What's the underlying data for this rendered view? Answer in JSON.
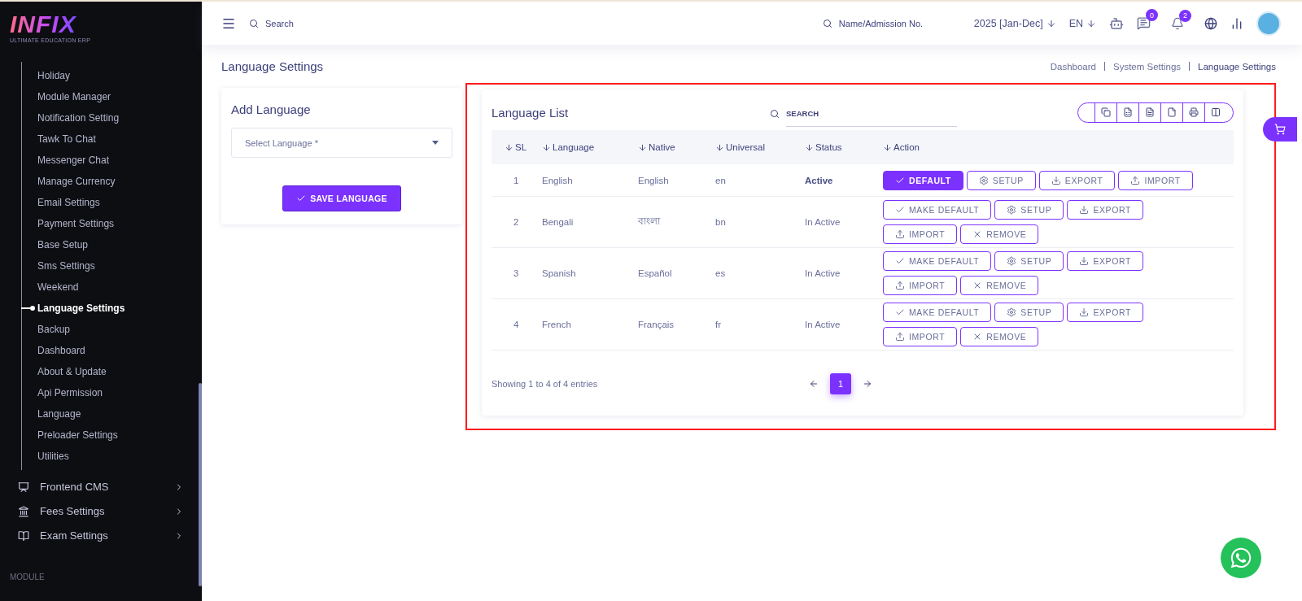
{
  "sidebar": {
    "logo": {
      "name": "INFIX",
      "tagline": "ULTIMATE EDUCATION ERP"
    },
    "sub_items": [
      {
        "label": "Holiday",
        "selected": false
      },
      {
        "label": "Module Manager",
        "selected": false
      },
      {
        "label": "Notification Setting",
        "selected": false
      },
      {
        "label": "Tawk To Chat",
        "selected": false
      },
      {
        "label": "Messenger Chat",
        "selected": false
      },
      {
        "label": "Manage Currency",
        "selected": false
      },
      {
        "label": "Email Settings",
        "selected": false
      },
      {
        "label": "Payment Settings",
        "selected": false
      },
      {
        "label": "Base Setup",
        "selected": false
      },
      {
        "label": "Sms Settings",
        "selected": false
      },
      {
        "label": "Weekend",
        "selected": false
      },
      {
        "label": "Language Settings",
        "selected": true
      },
      {
        "label": "Backup",
        "selected": false
      },
      {
        "label": "Dashboard",
        "selected": false
      },
      {
        "label": "About & Update",
        "selected": false
      },
      {
        "label": "Api Permission",
        "selected": false
      },
      {
        "label": "Language",
        "selected": false
      },
      {
        "label": "Preloader Settings",
        "selected": false
      },
      {
        "label": "Utilities",
        "selected": false
      }
    ],
    "groups": [
      {
        "label": "Frontend CMS",
        "kind": "cms"
      },
      {
        "label": "Fees Settings",
        "kind": "fees"
      },
      {
        "label": "Exam Settings",
        "kind": "exam"
      }
    ],
    "section_label": "MODULE"
  },
  "topbar": {
    "search_placeholder": "Search",
    "student_search_placeholder": "Name/Admission No.",
    "session": "2025 [Jan-Dec]",
    "language": "EN",
    "messages_count": "0",
    "notifications_count": "2"
  },
  "page_title": "Language Settings",
  "breadcrumb": [
    "Dashboard",
    "System Settings",
    "Language Settings"
  ],
  "add_language": {
    "title": "Add Language",
    "select_placeholder": "Select Language *",
    "save_button": "SAVE LANGUAGE"
  },
  "language_list": {
    "title": "Language List",
    "search_placeholder": "SEARCH",
    "columns": [
      "SL",
      "Language",
      "Native",
      "Universal",
      "Status",
      "Action"
    ],
    "rows": [
      {
        "sl": "1",
        "language": "English",
        "native": "English",
        "universal": "en",
        "status": "Active",
        "active": true,
        "actions": [
          {
            "kind": "default",
            "label": "DEFAULT"
          },
          {
            "kind": "setup",
            "label": "SETUP"
          },
          {
            "kind": "export",
            "label": "EXPORT"
          },
          {
            "kind": "import",
            "label": "IMPORT"
          }
        ]
      },
      {
        "sl": "2",
        "language": "Bengali",
        "native": "বাংলা",
        "universal": "bn",
        "status": "In Active",
        "active": false,
        "actions": [
          {
            "kind": "make_default",
            "label": "MAKE DEFAULT"
          },
          {
            "kind": "setup",
            "label": "SETUP"
          },
          {
            "kind": "export",
            "label": "EXPORT"
          },
          {
            "kind": "import",
            "label": "IMPORT"
          },
          {
            "kind": "remove",
            "label": "REMOVE"
          }
        ]
      },
      {
        "sl": "3",
        "language": "Spanish",
        "native": "Español",
        "universal": "es",
        "status": "In Active",
        "active": false,
        "actions": [
          {
            "kind": "make_default",
            "label": "MAKE DEFAULT"
          },
          {
            "kind": "setup",
            "label": "SETUP"
          },
          {
            "kind": "export",
            "label": "EXPORT"
          },
          {
            "kind": "import",
            "label": "IMPORT"
          },
          {
            "kind": "remove",
            "label": "REMOVE"
          }
        ]
      },
      {
        "sl": "4",
        "language": "French",
        "native": "Français",
        "universal": "fr",
        "status": "In Active",
        "active": false,
        "actions": [
          {
            "kind": "make_default",
            "label": "MAKE DEFAULT"
          },
          {
            "kind": "setup",
            "label": "SETUP"
          },
          {
            "kind": "export",
            "label": "EXPORT"
          },
          {
            "kind": "import",
            "label": "IMPORT"
          },
          {
            "kind": "remove",
            "label": "REMOVE"
          }
        ]
      }
    ],
    "info": "Showing 1 to 4 of 4 entries",
    "pages": [
      {
        "label": "1",
        "selected": true
      }
    ]
  }
}
